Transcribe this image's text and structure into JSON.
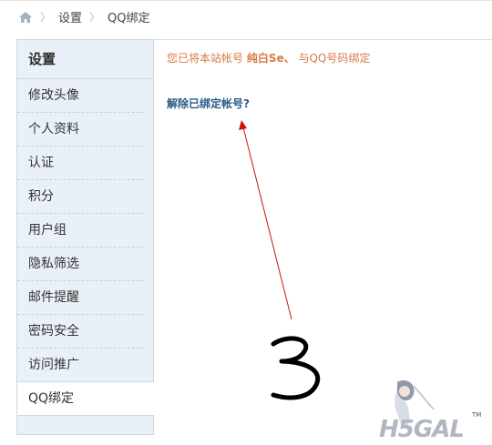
{
  "breadcrumb": {
    "items": [
      "设置",
      "QQ绑定"
    ]
  },
  "sidebar": {
    "title": "设置",
    "items": [
      {
        "label": "修改头像"
      },
      {
        "label": "个人资料"
      },
      {
        "label": "认证"
      },
      {
        "label": "积分"
      },
      {
        "label": "用户组"
      },
      {
        "label": "隐私筛选"
      },
      {
        "label": "邮件提醒"
      },
      {
        "label": "密码安全"
      },
      {
        "label": "访问推广"
      },
      {
        "label": "QQ绑定"
      }
    ]
  },
  "main": {
    "notice_prefix": "您已将本站帐号",
    "notice_account": "纯白Se、",
    "notice_suffix": "与QQ号码绑定",
    "unbind_label": "解除已绑定帐号?"
  },
  "annotation": {
    "number": "3"
  },
  "watermark": {
    "text": "H5GAL",
    "tm": "TM"
  },
  "colors": {
    "accent": "#d77a45",
    "link": "#2d5b87",
    "sidebar_bg": "#e9f0f7",
    "annotation_arrow": "#cc1111"
  }
}
